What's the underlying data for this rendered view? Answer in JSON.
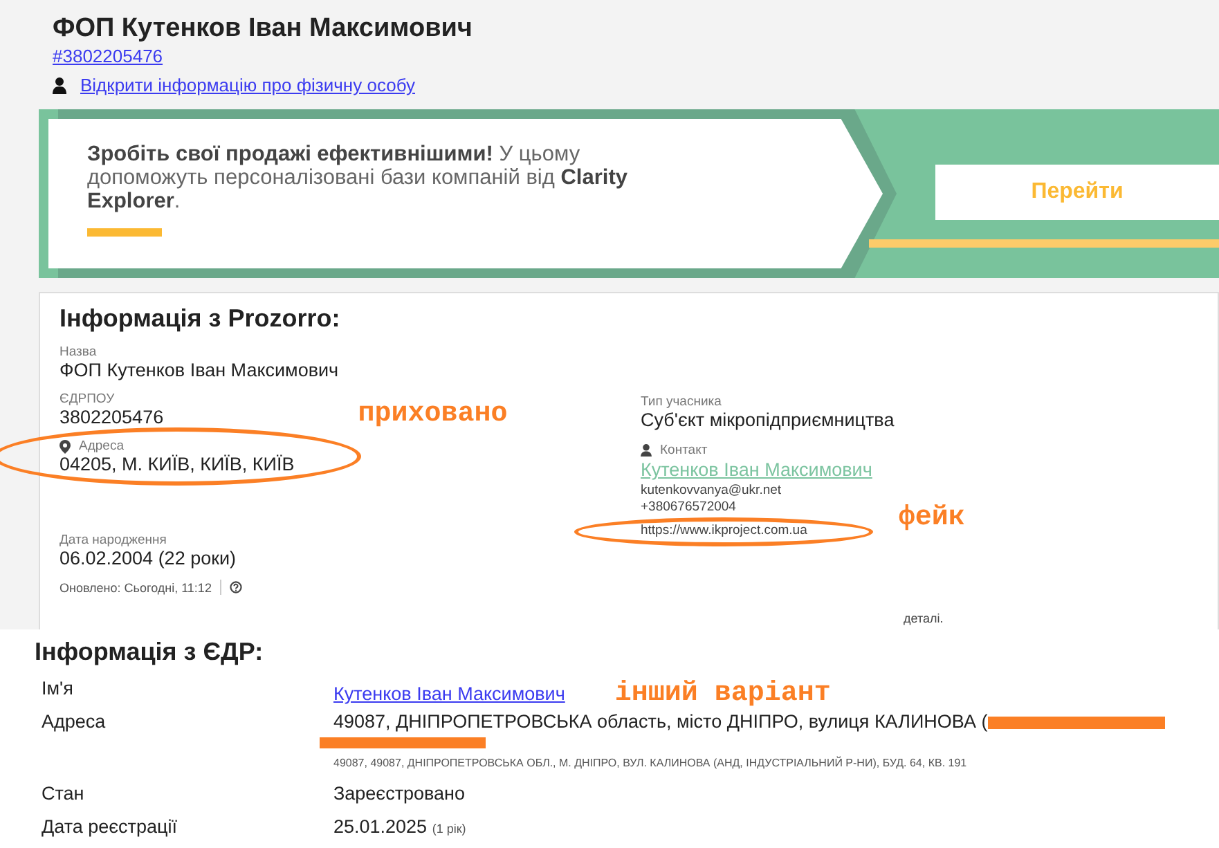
{
  "header": {
    "title": "ФОП Кутенков Іван Максимович",
    "id_link": "#3802205476",
    "person_link": "Відкрити інформацію про фізичну особу"
  },
  "banner": {
    "text": "**Зробіть свої продажі ефективнішими!** У цьому допоможуть персоналізовані бази компаній від **Clarity Explorer**.",
    "button": "Перейти"
  },
  "prozorro": {
    "title": "Інформація з Prozorro:",
    "left": [
      {
        "kind": "plain",
        "label": "Назва",
        "value": "ФОП Кутенков Іван Максимович"
      },
      {
        "kind": "plain",
        "label": "ЄДРПОУ",
        "value": "3802205476"
      },
      {
        "kind": "address",
        "label": "Адреса",
        "value": "04205, М. КИЇВ, КИЇВ, КИЇВ",
        "circled": true,
        "note": "приховано"
      },
      {
        "kind": "plain",
        "label": "Дата народження",
        "value": "06.02.2004 (22 роки)"
      }
    ],
    "updated": "Оновлено: Сьогодні, 11:12",
    "participant_type": {
      "label": "Тип учасника",
      "value": "Суб'єкт мікропідприємництва"
    },
    "contact": {
      "label": "Контакт",
      "name": "Кутенков Іван Максимович",
      "lines": [
        {
          "text": "kutenkovvanya@ukr.net"
        },
        {
          "text": "+380676572004"
        },
        {
          "text": "https://www.ikproject.com.ua",
          "circled": true,
          "note": "фейк"
        }
      ]
    },
    "details": "деталі."
  },
  "edr": {
    "title": "Інформація з ЄДР:",
    "rows": [
      {
        "kind": "link",
        "label": "Ім'я",
        "value": "Кутенков Іван Максимович",
        "note": "інший варіант"
      },
      {
        "kind": "address",
        "label": "Адреса",
        "value": "49087, ДНІПРОПЕТРОВСЬКА область, місто ДНІПРО, вулиця КАЛИНОВА (",
        "redacted": true,
        "sub": "49087, 49087, ДНІПРОПЕТРОВСЬКА ОБЛ., М. ДНІПРО, ВУЛ. КАЛИНОВА (АНД, ІНДУСТРІАЛЬНИЙ Р-НИ), БУД. 64, КВ. 191"
      },
      {
        "kind": "plain",
        "label": "Стан",
        "value": "Зареєстровано"
      },
      {
        "kind": "date",
        "label": "Дата реєстрації",
        "value": "25.01.2025",
        "extra": "(1 рік)"
      }
    ]
  }
}
